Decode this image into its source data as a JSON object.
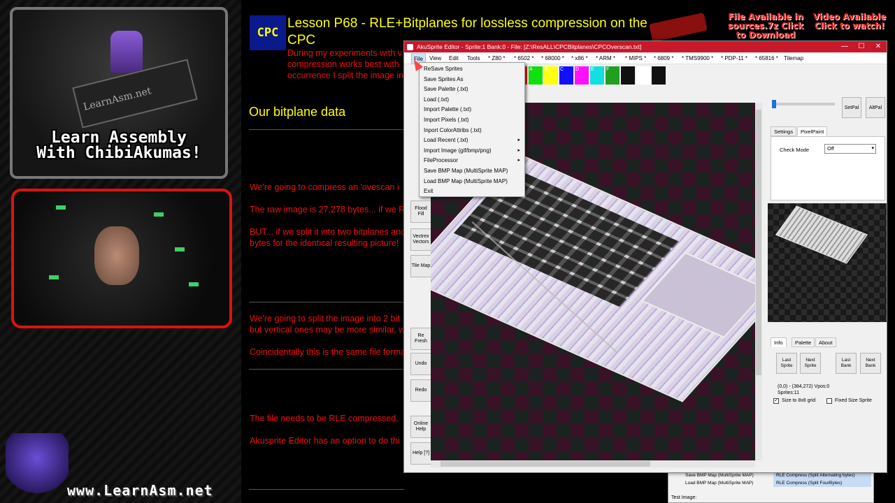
{
  "left": {
    "tagline_line1": "Learn Assembly",
    "tagline_line2": "With ChibiAkumas!",
    "chip_text": "LearnAsm.net",
    "site_url": "www.LearnAsm.net"
  },
  "doc": {
    "cpc_logo": "CPC",
    "lesson_title": "Lesson P68 - RLE+Bitplanes for lossless compression on the CPC",
    "intro": "During my experiments with v compression works best with occurrence I split the image in",
    "heading": "Our bitplane data",
    "p1": "We're going to compress an 'ovescan i",
    "p2": "The raw image is 27,278 bytes... if we R",
    "p3a": "BUT... if we split it into two bitplanes anc",
    "p3b": "bytes for the identical resulting picture!",
    "p4a": "We're going to split the image into 2 bit",
    "p4b": "but vertical ones may be more similar, w",
    "p5": "Coincidentally this is the same file forma",
    "p6": "The file needs to be RLE compressed,",
    "p7": "Akusprite Editor has an option to do thi",
    "promo1": "File Available in sources.7z Click to Download",
    "promo2": "Video Available Click to watch!"
  },
  "bg_sheet": {
    "row1": "Save BMP Map (MultiSprite MAP)",
    "row2": "Load BMP Map (MultiSprite MAP)",
    "row3": "RLE Compress (Split Alternating bytes)",
    "row4": "RLE Compress (Split FourBytes)",
    "hint": "[?]",
    "label": "Test Image:"
  },
  "window": {
    "title": "AkuSprite Editor - Sprite:1 Bank:0 - File: [Z:\\ResALL\\CPCBitplanes\\CPCOverscan.txt]",
    "minimize": "—",
    "maximize": "☐",
    "close": "✕"
  },
  "menu": [
    "File",
    "View",
    "Edit",
    "Tools",
    "* Z80 *",
    "* 6502 *",
    "* 68000 *",
    "* x86 *",
    "* ARM *",
    "* MIPS *",
    "* 6809 *",
    "* TMS9900 *",
    "* PDP-11 *",
    "* 65816 *",
    "Tilemap"
  ],
  "palette": {
    "labels": [
      "8",
      "9",
      "A",
      "B",
      "C",
      "D",
      "E",
      "F",
      "",
      "",
      ""
    ],
    "colors": [
      "#101010",
      "#ff1010",
      "#10e010",
      "#ffff10",
      "#1010ff",
      "#ff10ff",
      "#10e0e0",
      "#20a020",
      "#101010",
      "#ffffff",
      "#101010"
    ]
  },
  "tools": {
    "flood": "Flood Fill",
    "vector": "Vectrex Vectors",
    "tilemap": "Tile Map",
    "refresh": "Re Fresh",
    "undo": "Undo",
    "redo": "Redo",
    "online": "Online Help",
    "help": "Help [?]"
  },
  "right": {
    "setpal": "SetPal",
    "altpal": "AltPal",
    "tab_settings": "Settings",
    "tab_pixelpaint": "PixelPaint",
    "check_mode_label": "Check Mode",
    "check_mode_value": "Off",
    "tab_info": "Info",
    "tab_palette": "Palette",
    "tab_about": "About",
    "last_sprite": "Last Sprite",
    "next_sprite": "Next Sprite",
    "last_bank": "Last Bank",
    "next_bank": "Next Bank",
    "coords": "(0,0) - (384,272)  Vpos:0",
    "sprites": "Sprites:11",
    "size8": "Size to 8x8 grid",
    "fixed": "Fixed Size Sprite"
  },
  "file_menu": [
    {
      "label": "ReSave Sprites",
      "sub": false
    },
    {
      "label": "Save Sprites As",
      "sub": false
    },
    {
      "label": "Save Palette (.txt)",
      "sub": false
    },
    {
      "label": "Load (.txt)",
      "sub": false
    },
    {
      "label": "Import Palette (.txt)",
      "sub": false
    },
    {
      "label": "Import Pixels (.txt)",
      "sub": false
    },
    {
      "label": "Inport ColorAttribs (.txt)",
      "sub": false
    },
    {
      "label": "Load Recent (.txt)",
      "sub": true
    },
    {
      "label": "Import Image (gif/bmp/png)",
      "sub": true
    },
    {
      "label": "FileProcessor",
      "sub": true
    },
    {
      "label": "Save BMP Map (MultiSprite MAP)",
      "sub": false
    },
    {
      "label": "Load BMP Map (MultiSprite MAP)",
      "sub": false
    },
    {
      "label": "Exit",
      "sub": false
    }
  ],
  "icons": {
    "submenu": "▸",
    "caret": "▾",
    "check": "✓"
  },
  "colors": {
    "titlebar": "#c8182a",
    "doc_title": "#ffff00",
    "doc_text": "#ee1111"
  }
}
